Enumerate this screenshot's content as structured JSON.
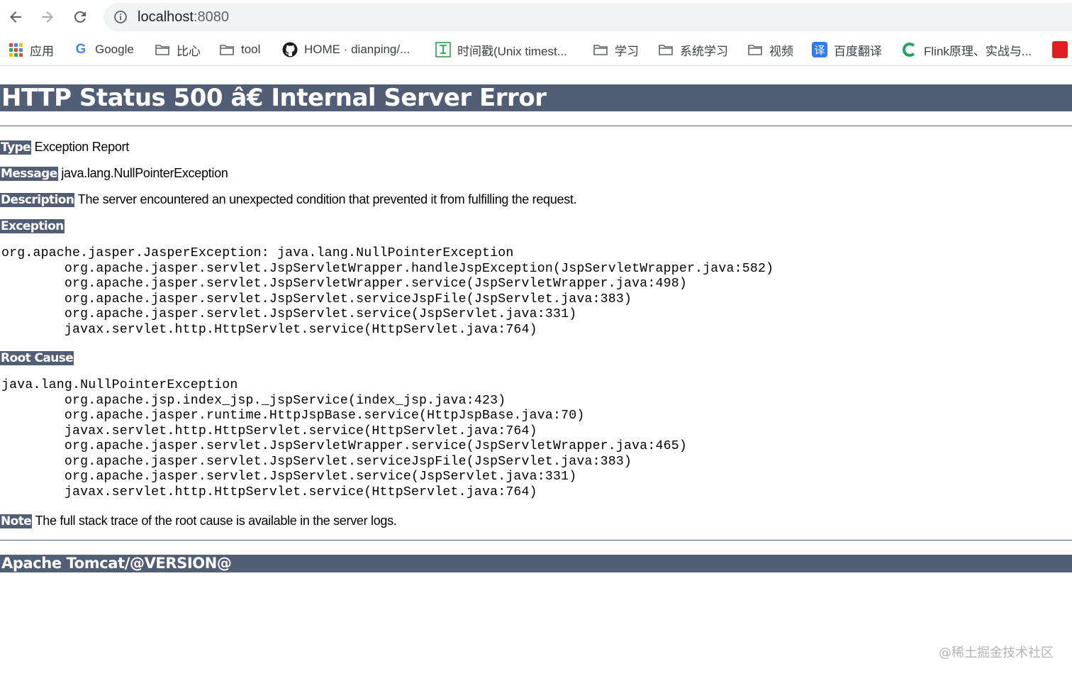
{
  "browser": {
    "url_host": "localhost",
    "url_port": ":8080",
    "bookmarks": [
      {
        "label": "应用",
        "icon": "apps-grid-icon"
      },
      {
        "label": "Google",
        "icon": "google-icon"
      },
      {
        "label": "比心",
        "icon": "folder-icon"
      },
      {
        "label": "tool",
        "icon": "folder-icon"
      },
      {
        "label": "HOME · dianping/...",
        "icon": "github-icon"
      },
      {
        "label": "时间戳(Unix timest...",
        "icon": "timestamp-icon"
      },
      {
        "label": "学习",
        "icon": "folder-icon"
      },
      {
        "label": "系统学习",
        "icon": "folder-icon"
      },
      {
        "label": "视频",
        "icon": "folder-icon"
      },
      {
        "label": "百度翻译",
        "icon": "fanyi-icon",
        "icon_text": "译"
      },
      {
        "label": "Flink原理、实战与...",
        "icon": "c-icon"
      }
    ]
  },
  "error_page": {
    "title": "HTTP Status 500 â€ Internal Server Error",
    "type_label": "Type",
    "type_value": "Exception Report",
    "message_label": "Message",
    "message_value": "java.lang.NullPointerException",
    "description_label": "Description",
    "description_value": "The server encountered an unexpected condition that prevented it from fulfilling the request.",
    "exception_label": "Exception",
    "exception_trace": "org.apache.jasper.JasperException: java.lang.NullPointerException\n\torg.apache.jasper.servlet.JspServletWrapper.handleJspException(JspServletWrapper.java:582)\n\torg.apache.jasper.servlet.JspServletWrapper.service(JspServletWrapper.java:498)\n\torg.apache.jasper.servlet.JspServlet.serviceJspFile(JspServlet.java:383)\n\torg.apache.jasper.servlet.JspServlet.service(JspServlet.java:331)\n\tjavax.servlet.http.HttpServlet.service(HttpServlet.java:764)",
    "root_cause_label": "Root Cause",
    "root_cause_trace": "java.lang.NullPointerException\n\torg.apache.jsp.index_jsp._jspService(index_jsp.java:423)\n\torg.apache.jasper.runtime.HttpJspBase.service(HttpJspBase.java:70)\n\tjavax.servlet.http.HttpServlet.service(HttpServlet.java:764)\n\torg.apache.jasper.servlet.JspServletWrapper.service(JspServletWrapper.java:465)\n\torg.apache.jasper.servlet.JspServlet.serviceJspFile(JspServlet.java:383)\n\torg.apache.jasper.servlet.JspServlet.service(JspServlet.java:331)\n\tjavax.servlet.http.HttpServlet.service(HttpServlet.java:764)",
    "note_label": "Note",
    "note_value": "The full stack trace of the root cause is available in the server logs.",
    "footer": "Apache Tomcat/@VERSION@"
  },
  "watermark": "@稀土掘金技术社区",
  "colors": {
    "tomcat_header": "#525d76",
    "omnibox_bg": "#f1f3f4"
  }
}
